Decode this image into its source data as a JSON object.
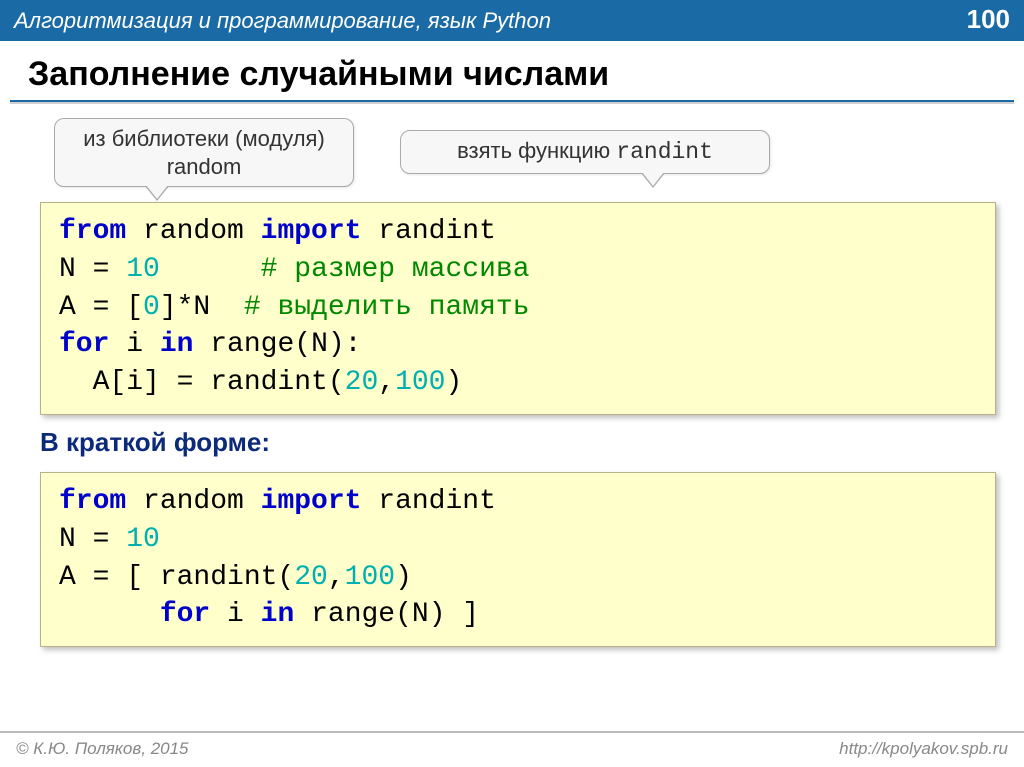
{
  "header": {
    "title": "Алгоритмизация и программирование, язык Python",
    "page": "100"
  },
  "title": "Заполнение случайными числами",
  "bubble": {
    "left_l1": "из библиотеки (модуля)",
    "left_l2": "random",
    "right_prefix": "взять функцию ",
    "right_mono": "randint"
  },
  "code1": {
    "l1a": "from",
    "l1b": " random ",
    "l1c": "import",
    "l1d": " randint",
    "l2a": "N = ",
    "l2b": "10",
    "l2c": "      ",
    "l2d": "# размер массива",
    "l3a": "A = [",
    "l3b": "0",
    "l3c": "]*N  ",
    "l3d": "# выделить память",
    "l4a": "for",
    "l4b": " i ",
    "l4c": "in",
    "l4d": " range(N):",
    "l5a": "  A[i] = randint(",
    "l5b": "20",
    "l5c": ",",
    "l5d": "100",
    "l5e": ")"
  },
  "subhead": "В краткой форме:",
  "code2": {
    "l1a": "from",
    "l1b": " random ",
    "l1c": "import",
    "l1d": " randint",
    "l2a": "N = ",
    "l2b": "10",
    "l3a": "A = [ randint(",
    "l3b": "20",
    "l3c": ",",
    "l3d": "100",
    "l3e": ") ",
    "l4a": "      ",
    "l4b": "for",
    "l4c": " i ",
    "l4d": "in",
    "l4e": " range(N) ]"
  },
  "footer": {
    "left": "© К.Ю. Поляков, 2015",
    "right": "http://kpolyakov.spb.ru"
  }
}
